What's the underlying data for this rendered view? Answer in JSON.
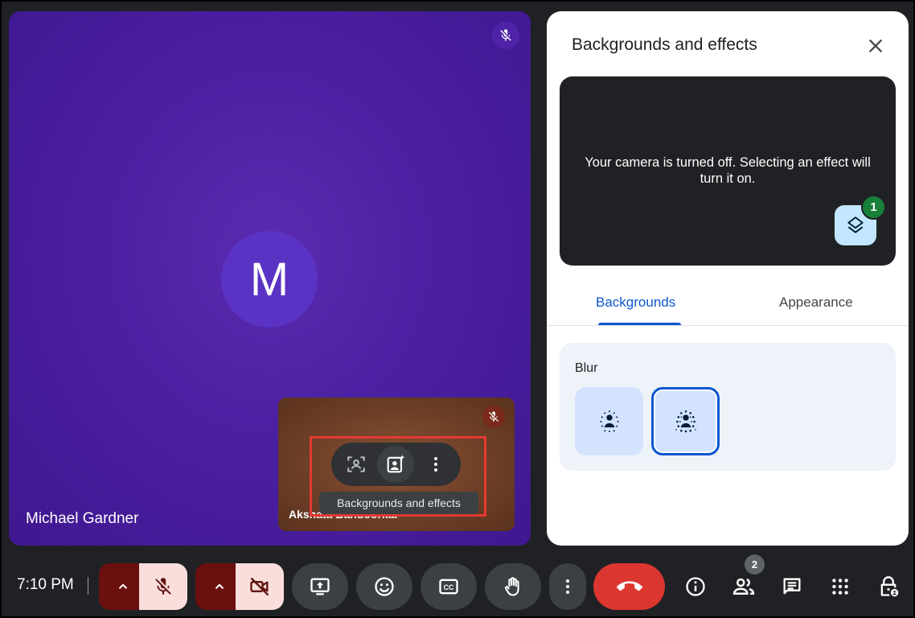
{
  "main_tile": {
    "avatar_letter": "M",
    "participant_name": "Michael Gardner"
  },
  "self_tile": {
    "participant_name": "Akshata Bandoorkar",
    "tooltip": "Backgrounds and effects"
  },
  "panel": {
    "title": "Backgrounds and effects",
    "preview_message": "Your camera is turned off. Selecting an effect will turn it on.",
    "layers_badge": "1",
    "tabs": [
      {
        "label": "Backgrounds"
      },
      {
        "label": "Appearance"
      }
    ],
    "blur": {
      "label": "Blur"
    }
  },
  "bottom_bar": {
    "time": "7:10 PM",
    "people_count": "2"
  },
  "colors": {
    "main_tile_bg": "#4b1fa2",
    "accent_blue": "#0b57d0",
    "hangup_red": "#dc3630",
    "badge_green": "#188038",
    "highlight_red": "#e53935"
  },
  "icons": [
    "mic-off-icon",
    "close-icon",
    "layers-icon",
    "frame-person-icon",
    "backgrounds-effects-icon",
    "more-vert-icon",
    "chevron-up-icon",
    "videocam-off-icon",
    "present-icon",
    "emoji-icon",
    "captions-icon",
    "raise-hand-icon",
    "call-end-icon",
    "info-icon",
    "people-icon",
    "chat-icon",
    "apps-icon",
    "host-controls-icon",
    "blur-slight-icon",
    "blur-full-icon"
  ]
}
